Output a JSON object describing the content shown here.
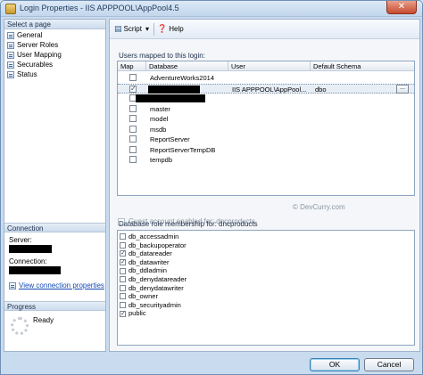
{
  "window": {
    "title": "Login Properties - IIS APPPOOL\\AppPool4.5",
    "close_glyph": "✕"
  },
  "left_pane": {
    "header": "Select a page",
    "pages": [
      "General",
      "Server Roles",
      "User Mapping",
      "Securables",
      "Status"
    ],
    "connection": {
      "header": "Connection",
      "server_label": "Server:",
      "connection_label": "Connection:",
      "view_link": "View connection properties"
    },
    "progress": {
      "header": "Progress",
      "status": "Ready"
    }
  },
  "toolbar": {
    "script_label": "Script",
    "dropdown_glyph": "▾",
    "help_label": "Help"
  },
  "users_mapped": {
    "label": "Users mapped to this login:",
    "columns": [
      "Map",
      "Database",
      "User",
      "Default Schema"
    ],
    "rows": [
      {
        "map": false,
        "database": "AdventureWorks2014",
        "user": "",
        "schema": ""
      },
      {
        "map": true,
        "database": "",
        "user": "IIS APPPOOL\\AppPool...",
        "schema": "dbo",
        "selected": true,
        "redacted": true
      },
      {
        "map": false,
        "database": "",
        "user": "",
        "schema": "",
        "redacted": true
      },
      {
        "map": false,
        "database": "master",
        "user": "",
        "schema": ""
      },
      {
        "map": false,
        "database": "model",
        "user": "",
        "schema": ""
      },
      {
        "map": false,
        "database": "msdb",
        "user": "",
        "schema": ""
      },
      {
        "map": false,
        "database": "ReportServer",
        "user": "",
        "schema": ""
      },
      {
        "map": false,
        "database": "ReportServerTempDB",
        "user": "",
        "schema": ""
      },
      {
        "map": false,
        "database": "tempdb",
        "user": "",
        "schema": ""
      }
    ],
    "ellipsis": "..."
  },
  "watermark": "© DevCurry.com",
  "guest_label": "Guest account enabled for: dncproducts",
  "roles": {
    "label": "Database role membership for: dncproducts",
    "items": [
      {
        "name": "db_accessadmin",
        "checked": false
      },
      {
        "name": "db_backupoperator",
        "checked": false
      },
      {
        "name": "db_datareader",
        "checked": true
      },
      {
        "name": "db_datawriter",
        "checked": true
      },
      {
        "name": "db_ddladmin",
        "checked": false
      },
      {
        "name": "db_denydatareader",
        "checked": false
      },
      {
        "name": "db_denydatawriter",
        "checked": false
      },
      {
        "name": "db_owner",
        "checked": false
      },
      {
        "name": "db_securityadmin",
        "checked": false
      },
      {
        "name": "public",
        "checked": true
      }
    ]
  },
  "buttons": {
    "ok": "OK",
    "cancel": "Cancel"
  },
  "check_glyph": "✓"
}
